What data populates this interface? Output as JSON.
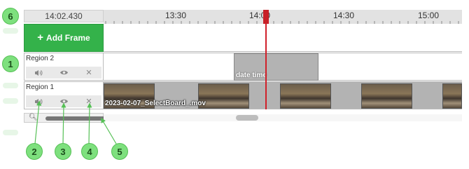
{
  "timeline": {
    "current_time": "14:02.430",
    "tick_labels": [
      "13:30",
      "14:00",
      "14:30",
      "15:00"
    ]
  },
  "add_frame": {
    "label": "Add Frame"
  },
  "tracks": [
    {
      "name": "Region 2",
      "clip_caption": "date time"
    },
    {
      "name": "Region 1",
      "clip_caption": "2023-02-07_SelectBoard_.mov"
    }
  ],
  "callouts": [
    "6",
    "1",
    "2",
    "3",
    "4",
    "5"
  ],
  "colors": {
    "accent": "#34b24a",
    "playhead": "#d0202a",
    "badge": "#7ee07e"
  }
}
